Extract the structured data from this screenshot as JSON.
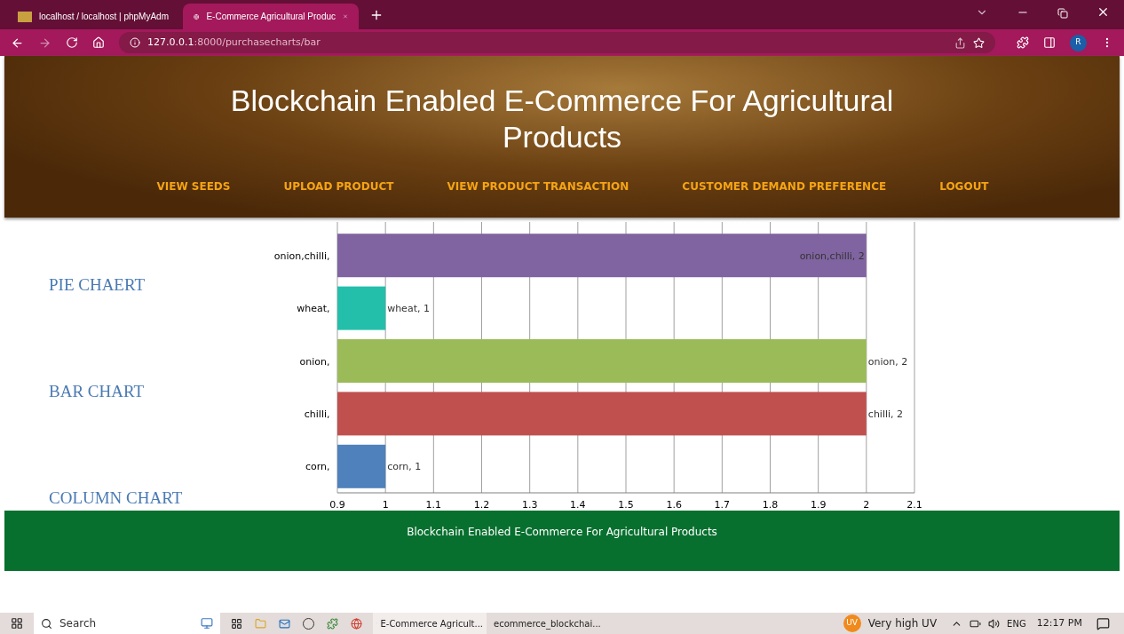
{
  "browser": {
    "tabs": [
      {
        "title": "localhost / localhost | phpMyAdm",
        "selected": false
      },
      {
        "title": "E-Commerce Agricultural Produc",
        "selected": true
      }
    ],
    "url_host": "127.0.0.1",
    "url_path": ":8000/purchasecharts/bar",
    "profile_initial": "R"
  },
  "header": {
    "title": "Blockchain Enabled E-Commerce For Agricultural Products",
    "nav": [
      "VIEW SEEDS",
      "UPLOAD PRODUCT",
      "VIEW PRODUCT TRANSACTION",
      "CUSTOMER DEMAND PREFERENCE",
      "LOGOUT"
    ]
  },
  "sidebar": {
    "links": [
      "PIE CHAERT",
      "BAR CHART",
      "COLUMN CHART"
    ]
  },
  "chart": {
    "category_separator": ",",
    "chart_data": {
      "type": "bar",
      "orientation": "horizontal",
      "categories": [
        "onion,chilli",
        "wheat",
        "onion",
        "chilli",
        "corn"
      ],
      "series": [
        {
          "values": [
            2,
            1,
            2,
            2,
            1
          ]
        }
      ],
      "grid": true,
      "colors": [
        "#8064a1",
        "#23bfaa",
        "#9bbb58",
        "#c0504e",
        "#4f81bc"
      ],
      "xlim": [
        0.9,
        2.1
      ],
      "xticks": [
        0.9,
        1,
        1.1,
        1.2,
        1.3,
        1.4,
        1.5,
        1.6,
        1.7,
        1.8,
        1.9,
        2,
        2.1
      ],
      "value_labels": [
        "onion,chilli, 2",
        "wheat, 1",
        "onion, 2",
        "chilli, 2",
        "corn, 1"
      ]
    }
  },
  "footer": {
    "text": "Blockchain Enabled E-Commerce For Agricultural Products"
  },
  "taskbar": {
    "search_placeholder": "Search",
    "windows": [
      {
        "label": "E-Commerce Agricult...",
        "selected": true
      },
      {
        "label": "ecommerce_blockchai...",
        "selected": false
      }
    ],
    "weather_badge": "UV",
    "weather": "Very high UV",
    "language": "ENG",
    "time": "12:17 PM"
  }
}
